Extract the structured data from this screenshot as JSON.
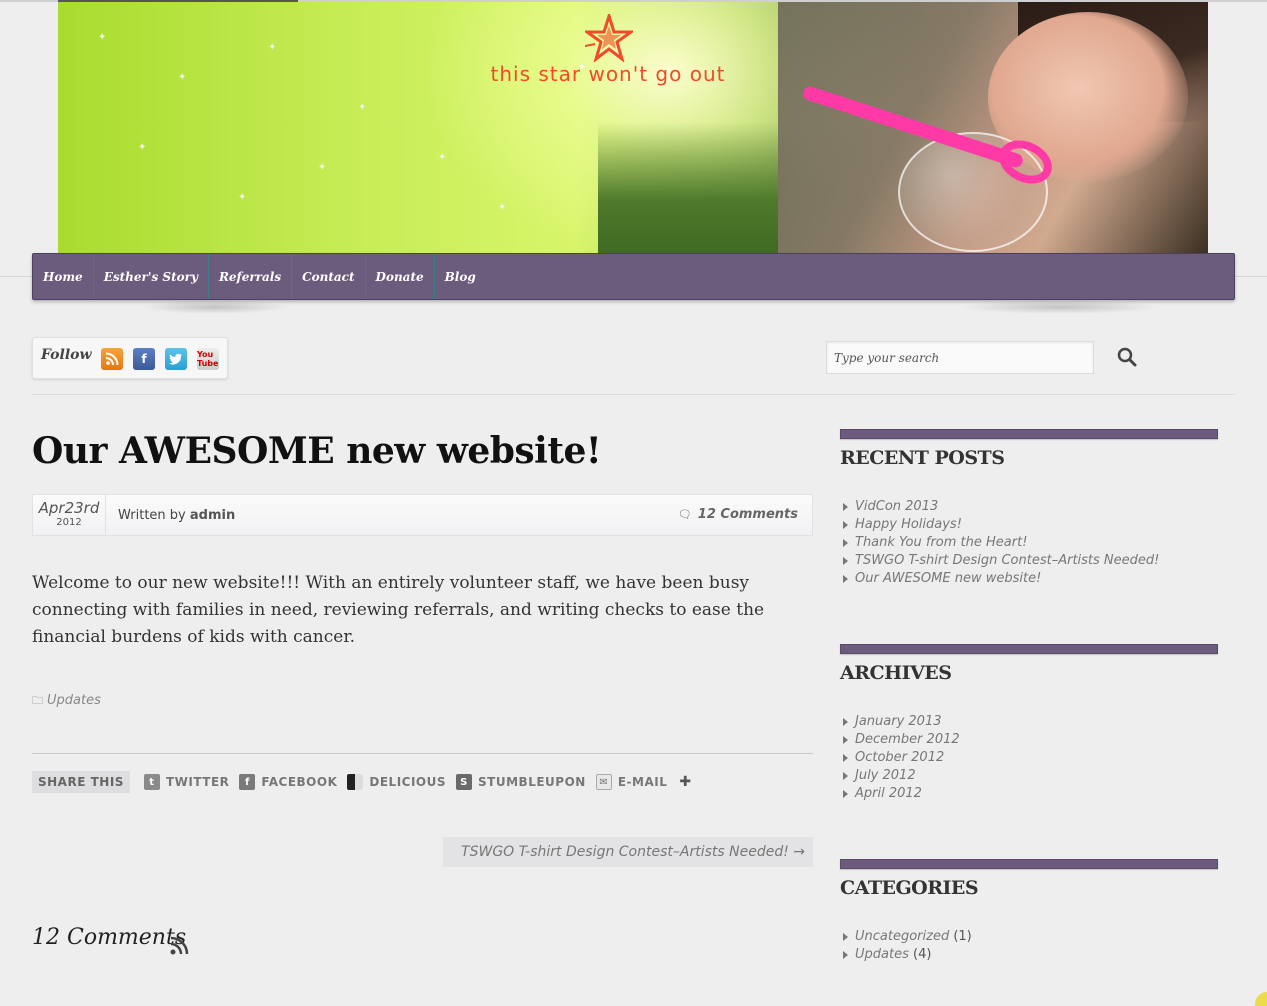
{
  "header": {
    "logo_text": "this star won't go out",
    "colors": {
      "banner_green": "#b8e63e",
      "logo_orange": "#f04c2c"
    }
  },
  "nav": {
    "items": [
      "Home",
      "Esther's Story",
      "Referrals",
      "Contact",
      "Donate",
      "Blog"
    ],
    "color": "#6b5b7d"
  },
  "follow": {
    "label": "Follow",
    "icons": [
      "rss-icon",
      "facebook-icon",
      "twitter-icon",
      "youtube-icon"
    ],
    "youtube_text": "You Tube"
  },
  "search": {
    "placeholder": "Type your search",
    "icon": "search-icon"
  },
  "post": {
    "title": "Our AWESOME new website!",
    "date_md": "Apr23rd",
    "date_year": "2012",
    "written_by": "Written by",
    "author": "admin",
    "comments_label": "12 Comments",
    "body": "Welcome to our new website!!! With an entirely volunteer staff, we have been busy connecting with families in need, reviewing referrals, and writing checks to ease the financial burdens of kids with cancer.",
    "category": "Updates"
  },
  "share": {
    "label": "SHARE THIS",
    "items": [
      "TWITTER",
      "FACEBOOK",
      "DELICIOUS",
      "STUMBLEUPON",
      "E-MAIL"
    ]
  },
  "next_post": "TSWGO T-shirt Design Contest–Artists Needed! →",
  "comments_heading": "12 Comments",
  "sidebar": {
    "recent_posts": {
      "title": "RECENT POSTS",
      "items": [
        "VidCon 2013",
        "Happy Holidays!",
        "Thank You from the Heart!",
        "TSWGO T-shirt Design Contest–Artists Needed!",
        "Our AWESOME new website!"
      ]
    },
    "archives": {
      "title": "ARCHIVES",
      "items": [
        "January 2013",
        "December 2012",
        "October 2012",
        "July 2012",
        "April 2012"
      ]
    },
    "categories": {
      "title": "CATEGORIES",
      "items": [
        {
          "name": "Uncategorized",
          "count": "(1)"
        },
        {
          "name": "Updates",
          "count": "(4)"
        }
      ]
    }
  }
}
